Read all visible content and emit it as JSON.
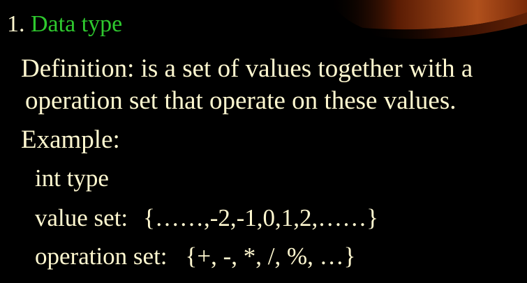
{
  "theme": {
    "background": "#000000",
    "text_color": "#fff8d0",
    "heading_color": "#2ec82e",
    "accent_swoosh": "#a04010"
  },
  "heading": {
    "number": "1. ",
    "title": "Data type"
  },
  "definition": {
    "line1": "Definition: is a set of values together with a",
    "line2": "operation set that operate on these values."
  },
  "example": {
    "label": "Example:",
    "type_name": "int type",
    "value_set_label": "value set:",
    "value_set": "{……,-2,-1,0,1,2,……}",
    "operation_set_label": "operation set:",
    "operation_set": "{+, -, *, /, %, …}"
  }
}
